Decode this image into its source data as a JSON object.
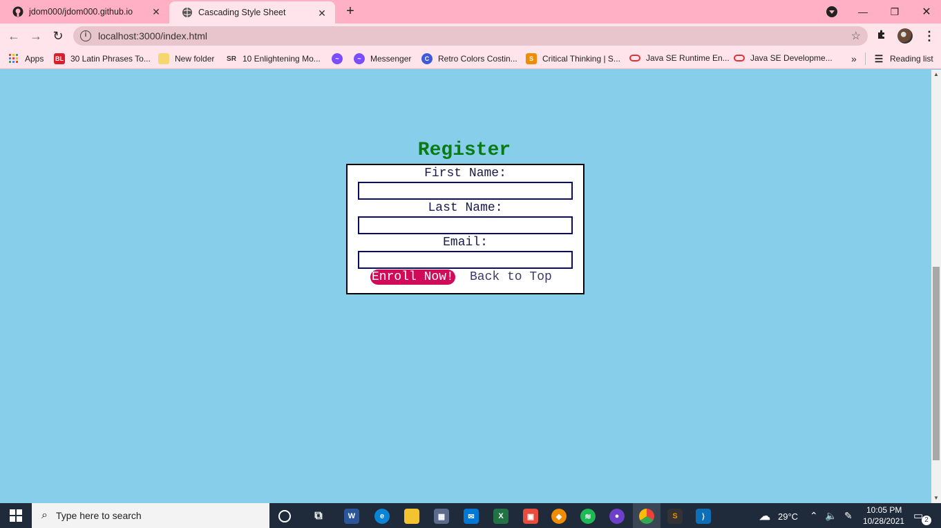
{
  "tabs": [
    {
      "title": "jdom000/jdom000.github.io",
      "icon": "github-icon"
    },
    {
      "title": "Cascading Style Sheet",
      "icon": "globe-icon"
    }
  ],
  "toolbar": {
    "url": "localhost:3000/index.html"
  },
  "bookmarks": {
    "items": [
      {
        "label": "Apps",
        "icon": "apps-grid-icon"
      },
      {
        "label": "30 Latin Phrases To...",
        "icon": "bl-icon",
        "icon_text": "BL",
        "color": "#d81e2c"
      },
      {
        "label": "New folder",
        "icon": "folder-icon",
        "color": "#f5d76e"
      },
      {
        "label": "10 Enlightening Mo...",
        "icon": "sr-icon",
        "icon_text": "SR",
        "color": "#333333"
      },
      {
        "label": "",
        "icon": "messenger-icon",
        "color": "#7b4dff"
      },
      {
        "label": "Messenger",
        "icon": "messenger-icon",
        "color": "#7b4dff"
      },
      {
        "label": "Retro Colors Costin...",
        "icon": "c-icon",
        "icon_text": "C",
        "color": "#3b5bdb"
      },
      {
        "label": "Critical Thinking | S...",
        "icon": "s-icon",
        "icon_text": "S",
        "color": "#f08c00"
      },
      {
        "label": "Java SE Runtime En...",
        "icon": "oracle-icon",
        "color": "#e03131"
      },
      {
        "label": "Java SE Developme...",
        "icon": "oracle-icon",
        "color": "#e03131"
      }
    ],
    "overflow": "»",
    "reading_list": "Reading list"
  },
  "form": {
    "title": "Register",
    "first_name_label": "First Name:",
    "last_name_label": "Last Name:",
    "email_label": "Email:",
    "first_name_value": "",
    "last_name_value": "",
    "email_value": "",
    "enroll_label": "Enroll Now!",
    "back_label": "Back to Top"
  },
  "taskbar": {
    "search_placeholder": "Type here to search",
    "temperature": "29°C",
    "time": "10:05 PM",
    "date": "10/28/2021",
    "notifications": "2"
  },
  "colors": {
    "page_bg": "#87ceeb",
    "title_green": "#0a7a14",
    "button_pink": "#d10a5a",
    "tab_strip": "#ffb0c4"
  }
}
